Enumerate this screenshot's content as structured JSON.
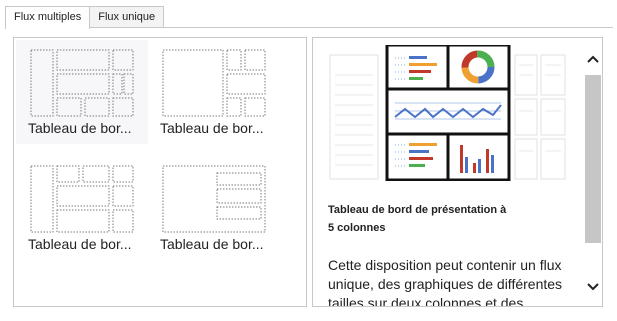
{
  "tabs": [
    {
      "label": "Flux multiples",
      "selected": true
    },
    {
      "label": "Flux unique",
      "selected": false
    }
  ],
  "layouts": [
    {
      "label": "Tableau de bor...",
      "selected": true
    },
    {
      "label": "Tableau de bor...",
      "selected": false
    },
    {
      "label": "Tableau de bor...",
      "selected": false
    },
    {
      "label": "Tableau de bor...",
      "selected": false
    }
  ],
  "preview": {
    "title_line1": "Tableau de bord de présentation à",
    "title_line2": "5 colonnes",
    "description": "Cette disposition peut contenir un flux unique, des graphiques de différentes tailles sur deux colonnes et des"
  },
  "colors": {
    "accent_blue": "#4a73c8",
    "accent_orange": "#f0a030",
    "accent_red": "#c0392b",
    "accent_green": "#4caf50"
  },
  "icons": {
    "scroll_up": "chevron-up-icon",
    "scroll_down": "chevron-down-icon"
  }
}
